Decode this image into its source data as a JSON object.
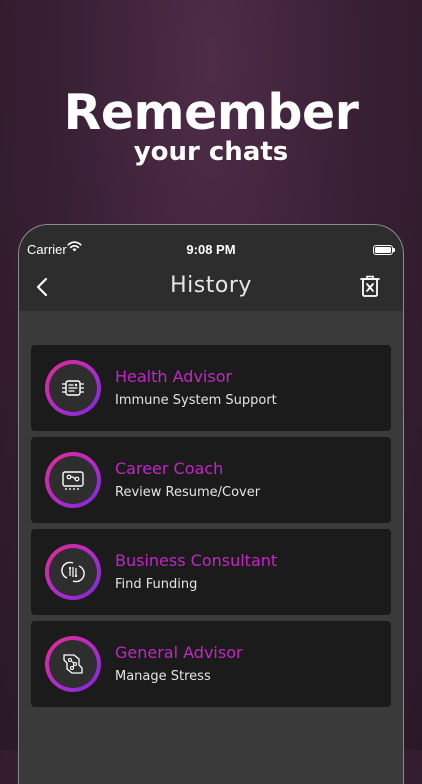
{
  "promo": {
    "headline": "Remember",
    "subline": "your chats"
  },
  "status_bar": {
    "carrier": "Carrier",
    "time": "9:08 PM"
  },
  "nav": {
    "title": "History",
    "back_icon": "chevron-left-icon",
    "delete_icon": "trash-icon"
  },
  "colors": {
    "accent": "#c226c4",
    "gradient_start": "#e62c8e",
    "gradient_end": "#7a2ad6"
  },
  "history": [
    {
      "title": "Health Advisor",
      "subtitle": "Immune System Support",
      "icon": "circuit-chip-icon"
    },
    {
      "title": "Career Coach",
      "subtitle": "Review Resume/Cover",
      "icon": "circuit-board-icon"
    },
    {
      "title": "Business Consultant",
      "subtitle": "Find Funding",
      "icon": "circuit-sync-icon"
    },
    {
      "title": "General Advisor",
      "subtitle": "Manage Stress",
      "icon": "circuit-brain-icon"
    }
  ]
}
